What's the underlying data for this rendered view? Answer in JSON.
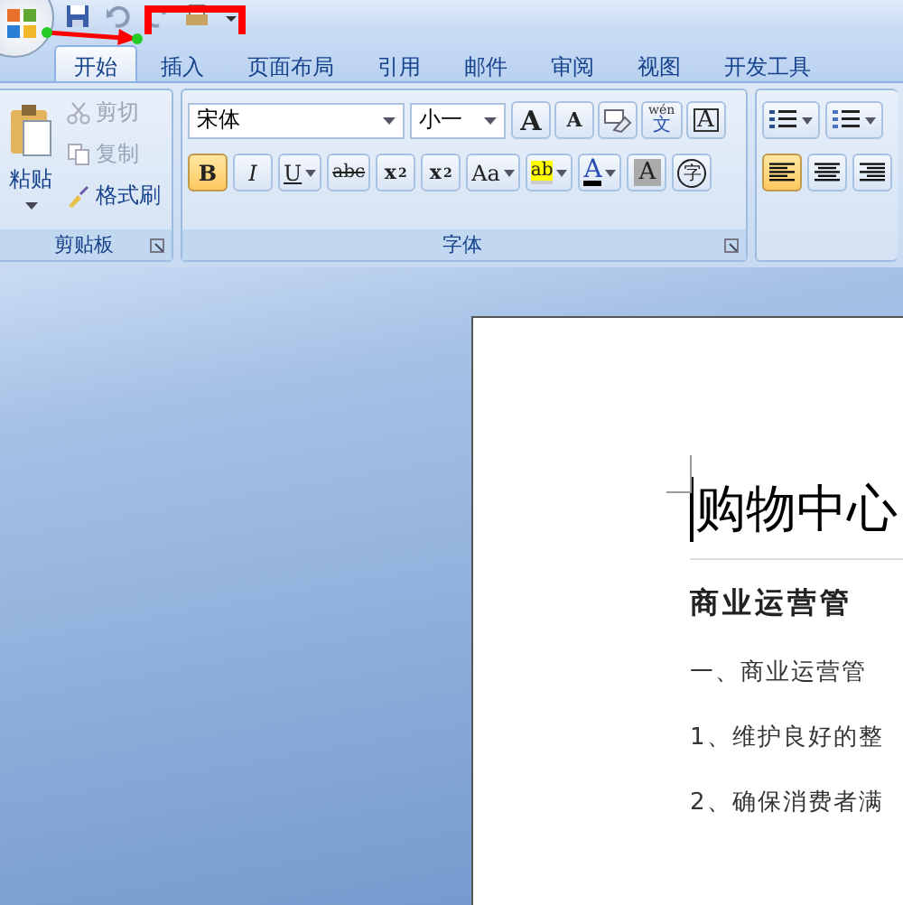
{
  "tabs": [
    {
      "label": "开始",
      "selected": true
    },
    {
      "label": "插入",
      "selected": false
    },
    {
      "label": "页面布局",
      "selected": false
    },
    {
      "label": "引用",
      "selected": false
    },
    {
      "label": "邮件",
      "selected": false
    },
    {
      "label": "审阅",
      "selected": false
    },
    {
      "label": "视图",
      "selected": false
    },
    {
      "label": "开发工具",
      "selected": false
    }
  ],
  "clipboard": {
    "paste_label": "粘贴",
    "items": [
      {
        "kind": "cut",
        "label": "剪切",
        "disabled": true
      },
      {
        "kind": "copy",
        "label": "复制",
        "disabled": true
      },
      {
        "kind": "painter",
        "label": "格式刷",
        "disabled": false
      }
    ],
    "group_label": "剪贴板"
  },
  "font": {
    "font_name": "宋体",
    "font_size": "小一",
    "group_label": "字体",
    "row1": [
      {
        "kind": "grow",
        "label": "A"
      },
      {
        "kind": "shrink",
        "label": "A"
      },
      {
        "kind": "clear"
      },
      {
        "kind": "pinyin",
        "label": "wén",
        "sub": "文"
      },
      {
        "kind": "border",
        "label": "A"
      }
    ],
    "row2": [
      {
        "kind": "bold",
        "label": "B",
        "selected": true
      },
      {
        "kind": "italic",
        "label": "I",
        "selected": false
      },
      {
        "kind": "underline",
        "label": "U",
        "selected": false,
        "dropdown": true
      },
      {
        "kind": "strike",
        "label": "abc",
        "selected": false
      },
      {
        "kind": "script",
        "label": "x",
        "sub": "2",
        "selected": false
      },
      {
        "kind": "script",
        "label": "x",
        "sup": "2",
        "selected": false
      },
      {
        "kind": "case",
        "label": "Aa",
        "selected": false,
        "dropdown": true
      },
      {
        "kind": "highlight",
        "label": "ab",
        "selected": false,
        "dropdown": true
      },
      {
        "kind": "fontcolor",
        "label": "A",
        "selected": false,
        "dropdown": true
      },
      {
        "kind": "shade",
        "label": "A",
        "selected": false
      },
      {
        "kind": "enclose",
        "label": "字",
        "selected": false
      }
    ]
  },
  "paragraph": {
    "lists": [
      {
        "kind": "bullets"
      },
      {
        "kind": "numbers"
      }
    ],
    "align": [
      {
        "kind": "left",
        "selected": true
      },
      {
        "kind": "center",
        "selected": false
      },
      {
        "kind": "right",
        "selected": false
      }
    ]
  },
  "document": {
    "title": "购物中心",
    "heading": "商业运营管",
    "lines": [
      "一、商业运营管",
      "1、维护良好的整",
      "2、确保消费者满"
    ]
  }
}
